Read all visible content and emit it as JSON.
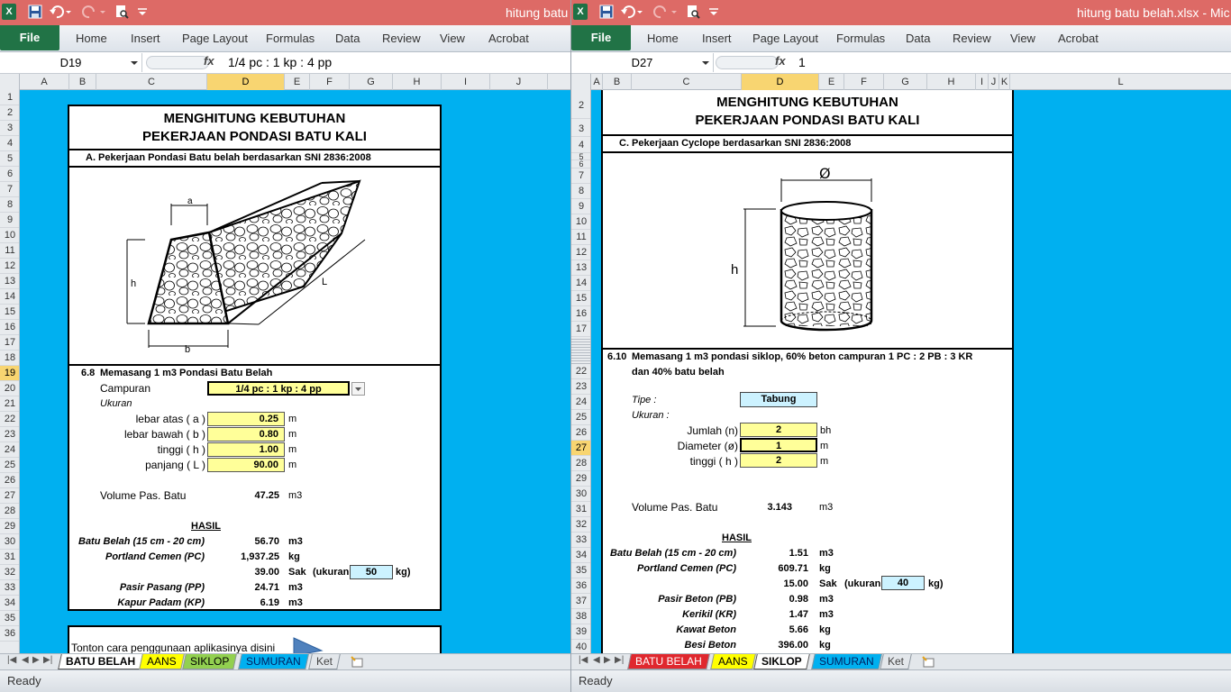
{
  "left": {
    "title": "hitung batu",
    "file_tab": "File",
    "tabs": [
      "Home",
      "Insert",
      "Page Layout",
      "Formulas",
      "Data",
      "Review",
      "View",
      "Acrobat"
    ],
    "name_box": "D19",
    "formula": "1/4 pc : 1 kp : 4 pp",
    "columns": [
      "A",
      "B",
      "C",
      "D",
      "E",
      "F",
      "G",
      "H",
      "I",
      "J"
    ],
    "rows": [
      "1",
      "2",
      "3",
      "4",
      "5",
      "6",
      "7",
      "8",
      "9",
      "10",
      "11",
      "12",
      "13",
      "14",
      "15",
      "16",
      "17",
      "18",
      "19",
      "20",
      "21",
      "22",
      "23",
      "24",
      "25",
      "26",
      "27",
      "28",
      "29",
      "30",
      "31",
      "32",
      "33",
      "34",
      "35",
      "36"
    ],
    "heading1": "MENGHITUNG KEBUTUHAN",
    "heading2": "PEKERJAAN PONDASI BATU KALI",
    "section": "A.  Pekerjaan Pondasi Batu belah berdasarkan SNI 2836:2008",
    "diagram_labels": {
      "a": "a",
      "h": "h",
      "L": "L",
      "b": "b"
    },
    "item_no": "6.8",
    "item_title": "Memasang 1 m3 Pondasi Batu Belah",
    "campuran_label": "Campuran",
    "campuran_value": "1/4 pc : 1 kp : 4 pp",
    "ukuran_label": "Ukuran",
    "dims": [
      {
        "label": "lebar atas ( a )",
        "value": "0.25",
        "unit": "m"
      },
      {
        "label": "lebar bawah ( b )",
        "value": "0.80",
        "unit": "m"
      },
      {
        "label": "tinggi ( h )",
        "value": "1.00",
        "unit": "m"
      },
      {
        "label": "panjang ( L )",
        "value": "90.00",
        "unit": "m"
      }
    ],
    "volume_label": "Volume Pas. Batu",
    "volume_value": "47.25",
    "volume_unit": "m3",
    "hasil": "HASIL",
    "results": [
      {
        "label": "Batu Belah (15 cm - 20 cm)",
        "value": "56.70",
        "unit": "m3"
      },
      {
        "label": "Portland Cemen (PC)",
        "value": "1,937.25",
        "unit": "kg"
      },
      {
        "label": "",
        "value": "39.00",
        "unit": "Sak"
      },
      {
        "label": "Pasir Pasang (PP)",
        "value": "24.71",
        "unit": "m3"
      },
      {
        "label": "Kapur Padam (KP)",
        "value": "6.19",
        "unit": "m3"
      }
    ],
    "ukuran_sak_label": "(ukuran",
    "ukuran_sak_value": "50",
    "ukuran_sak_unit": "kg)",
    "tonton": "Tonton cara penggunaan aplikasinya disini",
    "sheet_tabs": [
      "BATU BELAH",
      "AANS",
      "SIKLOP",
      "SUMURAN",
      "Ket"
    ],
    "status": "Ready"
  },
  "right": {
    "title": "hitung batu belah.xlsx  -  Mic",
    "file_tab": "File",
    "tabs": [
      "Home",
      "Insert",
      "Page Layout",
      "Formulas",
      "Data",
      "Review",
      "View",
      "Acrobat"
    ],
    "name_box": "D27",
    "formula": "1",
    "columns": [
      "A",
      "B",
      "C",
      "D",
      "E",
      "F",
      "G",
      "H",
      "I",
      "J",
      "K",
      "L"
    ],
    "rows": [
      "2",
      "3",
      "4",
      "5",
      "6",
      "7",
      "8",
      "9",
      "10",
      "11",
      "12",
      "13",
      "14",
      "15",
      "16",
      "17",
      "22",
      "23",
      "24",
      "25",
      "26",
      "27",
      "28",
      "29",
      "30",
      "31",
      "32",
      "33",
      "34",
      "35",
      "36",
      "37",
      "38",
      "39",
      "40"
    ],
    "heading1": "MENGHITUNG KEBUTUHAN",
    "heading2": "PEKERJAAN PONDASI BATU KALI",
    "section": "C.  Pekerjaan Cyclope berdasarkan SNI 2836:2008",
    "diagram_labels": {
      "dia": "Ø",
      "h": "h"
    },
    "item_no": "6.10",
    "item_line1": "Memasang 1 m3 pondasi siklop, 60% beton campuran 1 PC : 2 PB : 3 KR",
    "item_line2": "dan 40% batu belah",
    "tipe_label": "Tipe :",
    "tipe_value": "Tabung",
    "ukuran_label": "Ukuran :",
    "dims": [
      {
        "label": "Jumlah (n)",
        "value": "2",
        "unit": "bh"
      },
      {
        "label": "Diameter (ø)",
        "value": "1",
        "unit": "m"
      },
      {
        "label": "tinggi ( h )",
        "value": "2",
        "unit": "m"
      }
    ],
    "volume_label": "Volume Pas. Batu",
    "volume_value": "3.143",
    "volume_unit": "m3",
    "hasil": "HASIL",
    "results": [
      {
        "label": "Batu Belah (15 cm - 20 cm)",
        "value": "1.51",
        "unit": "m3"
      },
      {
        "label": "Portland Cemen (PC)",
        "value": "609.71",
        "unit": "kg"
      },
      {
        "label": "",
        "value": "15.00",
        "unit": "Sak"
      },
      {
        "label": "Pasir Beton (PB)",
        "value": "0.98",
        "unit": "m3"
      },
      {
        "label": "Kerikil (KR)",
        "value": "1.47",
        "unit": "m3"
      },
      {
        "label": "Kawat Beton",
        "value": "5.66",
        "unit": "kg"
      },
      {
        "label": "Besi Beton",
        "value": "396.00",
        "unit": "kg"
      }
    ],
    "ukuran_sak_label": "(ukuran",
    "ukuran_sak_value": "40",
    "ukuran_sak_unit": "kg)",
    "sheet_tabs": [
      "BATU BELAH",
      "AANS",
      "SIKLOP",
      "SUMURAN",
      "Ket"
    ],
    "status": "Ready"
  },
  "colors": {
    "titlebar": "#dd6a66",
    "file_tab": "#217346",
    "sheet_bg": "#00b0f0",
    "input_fill": "#ffff99",
    "cyan_fill": "#ccf2ff",
    "header_selected": "#f8d571"
  }
}
